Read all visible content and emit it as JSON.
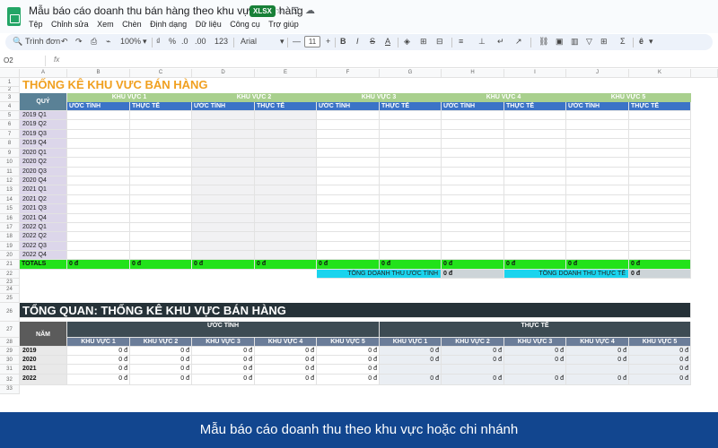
{
  "app": {
    "doc_title": "Mẫu báo cáo doanh thu bán hàng theo khu vực bán hàng",
    "file_badge": "XLSX",
    "menu": [
      "Tệp",
      "Chỉnh sửa",
      "Xem",
      "Chèn",
      "Định dạng",
      "Dữ liệu",
      "Công cụ",
      "Trợ giúp"
    ],
    "toolbar": {
      "search": "Trình đơn",
      "zoom": "100%",
      "currency": "₫",
      "percent": "%",
      "decimals_less": ".0",
      "decimals_more": ".00",
      "num_format": "123",
      "font": "Arial",
      "minus": "—",
      "font_size": "11",
      "plus": "+"
    },
    "name_box": "O2",
    "fx_label": "fx"
  },
  "sheet": {
    "columns": [
      "A",
      "B",
      "C",
      "D",
      "E",
      "F",
      "G",
      "H",
      "I",
      "J",
      "K"
    ],
    "rows": [
      "1",
      "2",
      "3",
      "4",
      "5",
      "6",
      "7",
      "8",
      "9",
      "10",
      "11",
      "12",
      "13",
      "14",
      "15",
      "16",
      "17",
      "18",
      "19",
      "20",
      "21",
      "22",
      "23",
      "24",
      "25",
      "26",
      "27",
      "28",
      "29",
      "30",
      "31",
      "32",
      "33"
    ],
    "title": "THỐNG KÊ KHU VỰC BÁN HÀNG",
    "quy_header": "QUÝ",
    "regions": [
      "KHU VỰC 1",
      "KHU VỰC 2",
      "KHU VỰC 3",
      "KHU VỰC 4",
      "KHU VỰC 5"
    ],
    "subheaders": [
      "ƯỚC TÍNH",
      "THỰC TẾ"
    ],
    "quarters": [
      "2019 Q1",
      "2019 Q2",
      "2019 Q3",
      "2019 Q4",
      "2020 Q1",
      "2020 Q2",
      "2020 Q3",
      "2020 Q4",
      "2021 Q1",
      "2021 Q2",
      "2021 Q3",
      "2021 Q4",
      "2022 Q1",
      "2022 Q2",
      "2022 Q3",
      "2022 Q4"
    ],
    "totals_label": "TOTALS",
    "totals": [
      "0 đ",
      "0 đ",
      "0 đ",
      "0 đ",
      "0 đ",
      "0 đ",
      "0 đ",
      "0 đ",
      "0 đ",
      "0 đ"
    ],
    "total_estimate_label": "TỔNG DOANH THU ƯỚC TÍNH",
    "total_estimate_value": "0 đ",
    "total_actual_label": "TỔNG DOANH THU THỰC TẾ",
    "total_actual_value": "0 đ",
    "overview_title": "TỔNG QUAN: THỐNG KÊ KHU VỰC BÁN HÀNG",
    "overview_group_estimate": "ƯỚC TÍNH",
    "overview_group_actual": "THỰC TẾ",
    "nam_header": "NĂM",
    "years": [
      "2019",
      "2020",
      "2021",
      "2022"
    ],
    "overview_values": [
      [
        "0 đ",
        "0 đ",
        "0 đ",
        "0 đ",
        "0 đ",
        "0 đ",
        "0 đ",
        "0 đ",
        "0 đ",
        "0 đ"
      ],
      [
        "0 đ",
        "0 đ",
        "0 đ",
        "0 đ",
        "0 đ",
        "0 đ",
        "0 đ",
        "0 đ",
        "0 đ",
        "0 đ"
      ],
      [
        "0 đ",
        "0 đ",
        "0 đ",
        "0 đ",
        "0 đ",
        "",
        "",
        "",
        "",
        "0 đ"
      ],
      [
        "0 đ",
        "0 đ",
        "0 đ",
        "0 đ",
        "0 đ",
        "0 đ",
        "0 đ",
        "0 đ",
        "0 đ",
        "0 đ"
      ]
    ]
  },
  "banner": "Mẫu báo cáo doanh thu theo khu vực hoặc chi nhánh"
}
